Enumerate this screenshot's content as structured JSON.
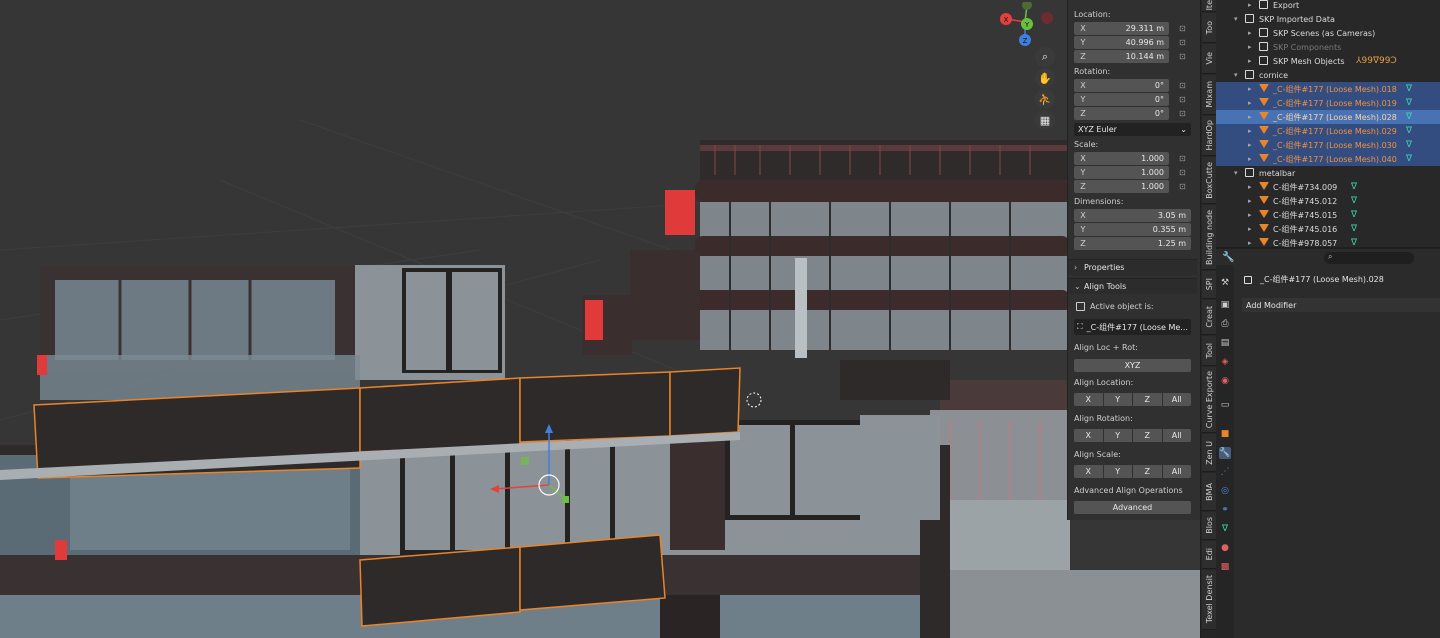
{
  "npanel": {
    "location_label": "Location:",
    "location": [
      {
        "axis": "X",
        "value": "29.311 m"
      },
      {
        "axis": "Y",
        "value": "40.996 m"
      },
      {
        "axis": "Z",
        "value": "10.144 m"
      }
    ],
    "rotation_label": "Rotation:",
    "rotation": [
      {
        "axis": "X",
        "value": "0°"
      },
      {
        "axis": "Y",
        "value": "0°"
      },
      {
        "axis": "Z",
        "value": "0°"
      }
    ],
    "rotation_mode": "XYZ Euler",
    "scale_label": "Scale:",
    "scale": [
      {
        "axis": "X",
        "value": "1.000"
      },
      {
        "axis": "Y",
        "value": "1.000"
      },
      {
        "axis": "Z",
        "value": "1.000"
      }
    ],
    "dimensions_label": "Dimensions:",
    "dimensions": [
      {
        "axis": "X",
        "value": "3.05 m"
      },
      {
        "axis": "Y",
        "value": "0.355 m"
      },
      {
        "axis": "Z",
        "value": "1.25 m"
      }
    ],
    "properties_header": "Properties",
    "align_tools_header": "Align Tools",
    "active_object_label": "Active object is:",
    "active_object_name": "_C-组件#177 (Loose Me...",
    "align_loc_rot_label": "Align Loc + Rot:",
    "align_loc_rot_button": "XYZ",
    "align_location_label": "Align Location:",
    "align_rotation_label": "Align Rotation:",
    "align_scale_label": "Align Scale:",
    "axis_buttons": [
      "X",
      "Y",
      "Z",
      "All"
    ],
    "advanced_label": "Advanced Align Operations",
    "advanced_button": "Advanced"
  },
  "vtabs": [
    "Ite",
    "Too",
    "Vie",
    "Mixam",
    "HardOp",
    "BoxCutte",
    "Building node",
    "SPI",
    "Creat",
    "Tool",
    "Curve Exporte",
    "Zen U",
    "BMA",
    "Blos",
    "Edi",
    "Texel Densit"
  ],
  "outliner": {
    "rows": [
      {
        "label": "Export",
        "indent": 2,
        "type": "collection",
        "state": "normal"
      },
      {
        "label": "SKP Imported Data",
        "indent": 1,
        "type": "collection",
        "state": "normal",
        "expanded": true
      },
      {
        "label": "SKP Scenes (as Cameras)",
        "indent": 2,
        "type": "collection",
        "state": "normal"
      },
      {
        "label": "SKP Components",
        "indent": 2,
        "type": "collection",
        "state": "dim"
      },
      {
        "label": "SKP Mesh Objects",
        "indent": 2,
        "type": "collection",
        "state": "normal",
        "extra": "⅄99∇99Ↄ"
      },
      {
        "label": "cornice",
        "indent": 1,
        "type": "collection",
        "state": "normal",
        "expanded": true
      },
      {
        "label": "_C-组件#177 (Loose Mesh).018",
        "indent": 2,
        "type": "mesh",
        "state": "selected"
      },
      {
        "label": "_C-组件#177 (Loose Mesh).019",
        "indent": 2,
        "type": "mesh",
        "state": "selected"
      },
      {
        "label": "_C-组件#177 (Loose Mesh).028",
        "indent": 2,
        "type": "mesh",
        "state": "active"
      },
      {
        "label": "_C-组件#177 (Loose Mesh).029",
        "indent": 2,
        "type": "mesh",
        "state": "selected"
      },
      {
        "label": "_C-组件#177 (Loose Mesh).030",
        "indent": 2,
        "type": "mesh",
        "state": "selected"
      },
      {
        "label": "_C-组件#177 (Loose Mesh).040",
        "indent": 2,
        "type": "mesh",
        "state": "selected"
      },
      {
        "label": "metalbar",
        "indent": 1,
        "type": "collection",
        "state": "normal",
        "expanded": true
      },
      {
        "label": "C-组件#734.009",
        "indent": 2,
        "type": "mesh",
        "state": "normal"
      },
      {
        "label": "C-组件#745.012",
        "indent": 2,
        "type": "mesh",
        "state": "normal"
      },
      {
        "label": "C-组件#745.015",
        "indent": 2,
        "type": "mesh",
        "state": "normal"
      },
      {
        "label": "C-组件#745.016",
        "indent": 2,
        "type": "mesh",
        "state": "normal"
      },
      {
        "label": "C-组件#978.057",
        "indent": 2,
        "type": "mesh",
        "state": "normal"
      }
    ]
  },
  "properties": {
    "object_name": "_C-组件#177 (Loose Mesh).028",
    "add_modifier": "Add Modifier",
    "search_placeholder": ""
  },
  "gizmo": {
    "x": "X",
    "y": "Y",
    "z": "Z"
  },
  "colors": {
    "accent": "#4772b3",
    "selected_orange": "#e8842a",
    "mesh_teal": "#3dd5b0",
    "x_red": "#e4413d",
    "y_green": "#6cc040",
    "z_blue": "#3f7fe0"
  }
}
